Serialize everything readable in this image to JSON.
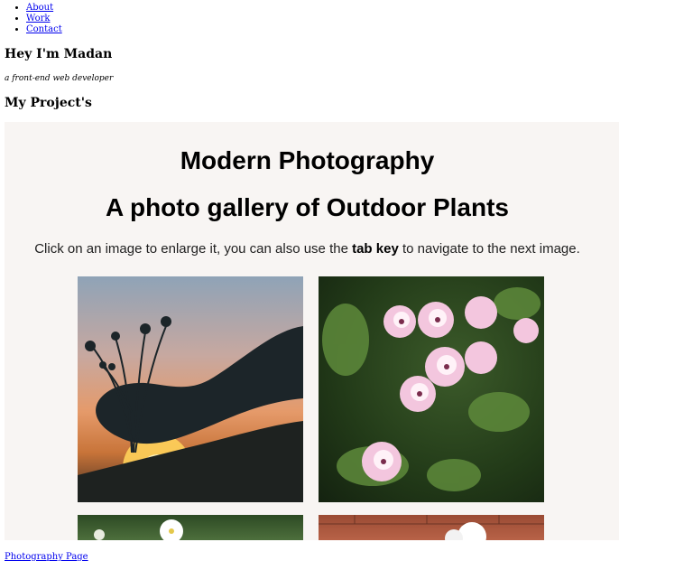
{
  "nav": {
    "items": [
      "About",
      "Work",
      "Contact"
    ]
  },
  "intro": {
    "heading": "Hey I'm Madan",
    "tagline": "a front-end web developer"
  },
  "projects": {
    "heading": "My Project's"
  },
  "preview": {
    "title": "Modern Photography",
    "subtitle": "A photo gallery of Outdoor Plants",
    "desc_before": "Click on an image to enlarge it, you can also use the ",
    "desc_bold": "tab key",
    "desc_after": " to navigate to the next image."
  },
  "footer": {
    "link": "Photography Page"
  },
  "colors": {
    "link": "#0000ee",
    "preview_bg": "#f8f5f3"
  }
}
